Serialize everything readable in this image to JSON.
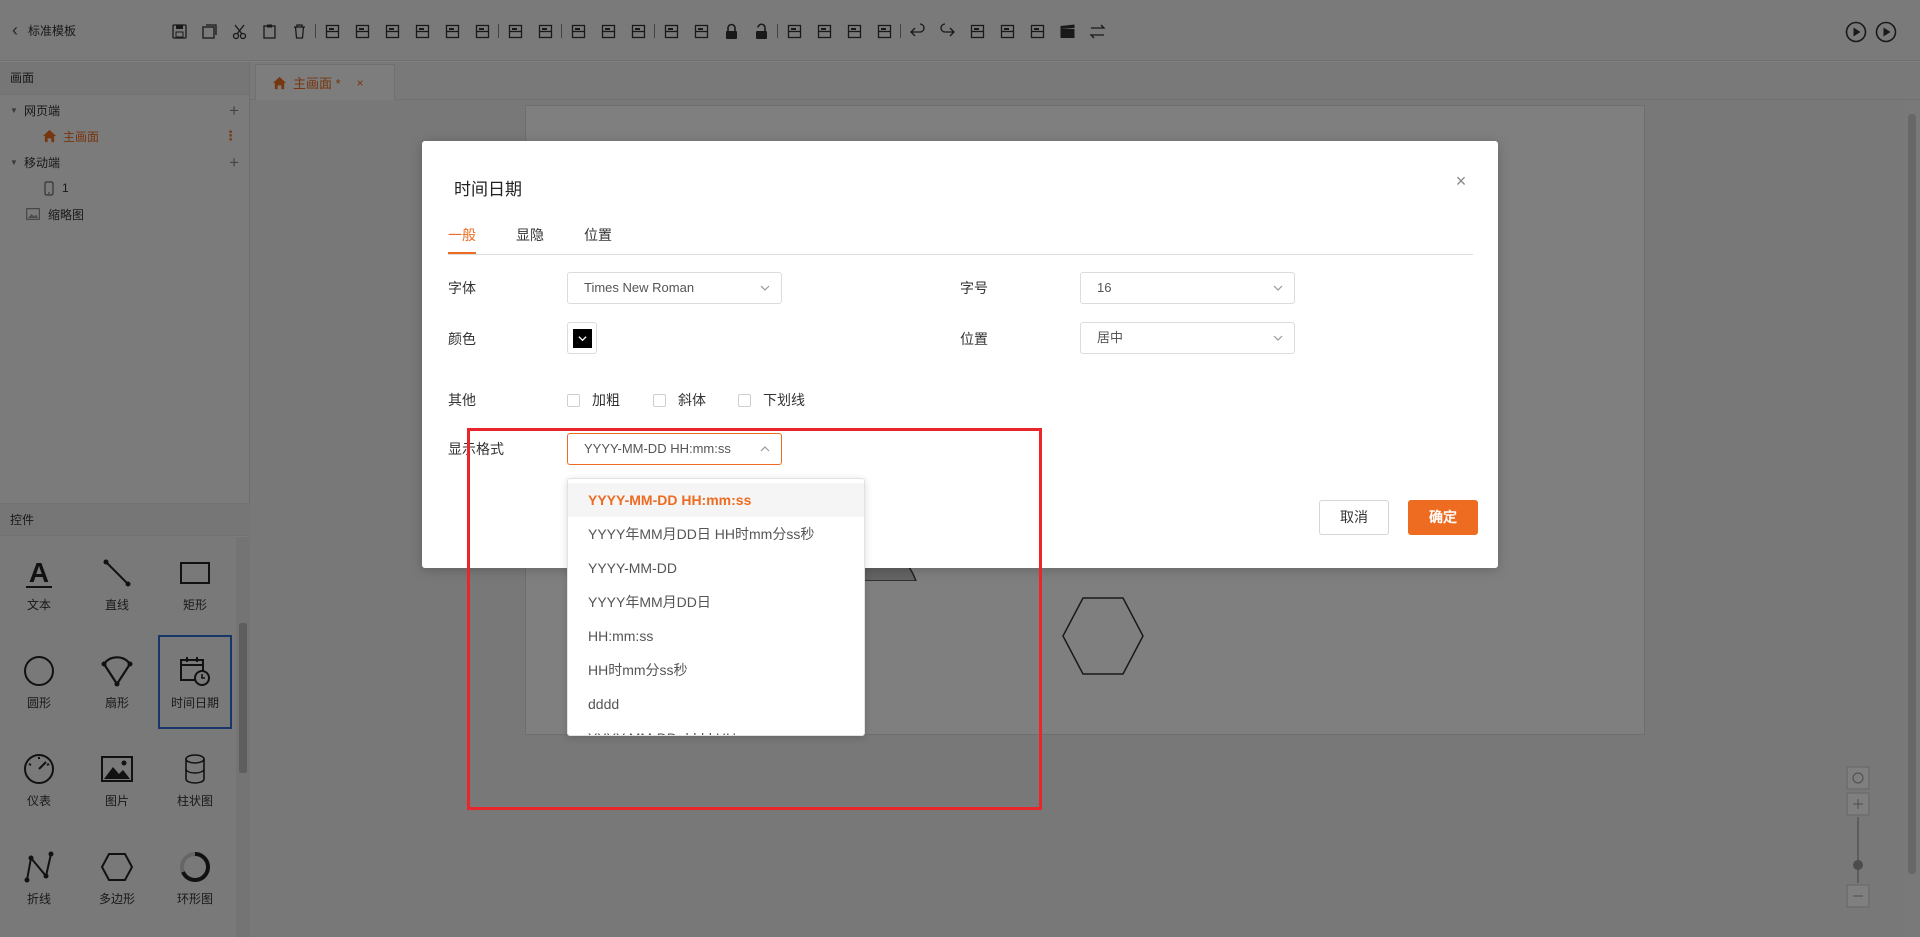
{
  "header": {
    "back_label": "标准模板",
    "tool_icons": [
      "save-icon",
      "save-as-icon",
      "cut-icon",
      "paste-icon",
      "delete-icon",
      "align-left-icon",
      "align-right-icon",
      "align-top-icon",
      "align-bottom-icon",
      "align-center-h-icon",
      "align-center-v-icon",
      "distribute-h-icon",
      "distribute-v-icon",
      "grid-icon",
      "same-height-icon",
      "same-width-icon",
      "group-icon",
      "ungroup-icon",
      "lock-icon",
      "unlock-icon",
      "bring-front-icon",
      "send-back-icon",
      "bring-forward-icon",
      "send-backward-icon",
      "undo-icon",
      "redo-icon",
      "image-icon",
      "layers-icon",
      "format-icon",
      "clapper-icon",
      "swap-icon"
    ]
  },
  "left_panel": {
    "section_title": "画面",
    "tree": {
      "web_group": "网页端",
      "main_page": "主画面",
      "mobile_group": "移动端",
      "mobile_item": "1",
      "thumbnail": "缩略图"
    },
    "controls_title": "控件",
    "palette": [
      {
        "label": "文本",
        "icon": "text-icon"
      },
      {
        "label": "直线",
        "icon": "line-icon"
      },
      {
        "label": "矩形",
        "icon": "rectangle-icon"
      },
      {
        "label": "圆形",
        "icon": "circle-icon"
      },
      {
        "label": "扇形",
        "icon": "sector-icon"
      },
      {
        "label": "时间日期",
        "icon": "calendar-clock-icon"
      },
      {
        "label": "仪表",
        "icon": "gauge-icon"
      },
      {
        "label": "图片",
        "icon": "picture-icon"
      },
      {
        "label": "柱状图",
        "icon": "cylinder-icon"
      },
      {
        "label": "折线",
        "icon": "polyline-icon"
      },
      {
        "label": "多边形",
        "icon": "hexagon-icon"
      },
      {
        "label": "环形图",
        "icon": "ring-icon"
      }
    ]
  },
  "tabs": {
    "active_tab": "主画面 *",
    "close": "×"
  },
  "dialog": {
    "title": "时间日期",
    "close": "×",
    "tabs": [
      "一般",
      "显隐",
      "位置"
    ],
    "font_label": "字体",
    "font_value": "Times New Roman",
    "size_label": "字号",
    "size_value": "16",
    "color_label": "颜色",
    "align_label": "位置",
    "align_value": "居中",
    "other_label": "其他",
    "bold": "加粗",
    "italic": "斜体",
    "underline": "下划线",
    "format_label": "显示格式",
    "format_value": "YYYY-MM-DD HH:mm:ss",
    "cancel": "取消",
    "ok": "确定"
  },
  "format_options": [
    "YYYY-MM-DD HH:mm:ss",
    "YYYY年MM月DD日 HH时mm分ss秒",
    "YYYY-MM-DD",
    "YYYY年MM月DD日",
    "HH:mm:ss",
    "HH时mm分ss秒",
    "dddd",
    "YYYY-MM-DD dddd HH:mm:ss"
  ],
  "colors": {
    "accent": "#ed6c21",
    "highlight": "#e8262b",
    "selection": "#2f6fd0"
  }
}
